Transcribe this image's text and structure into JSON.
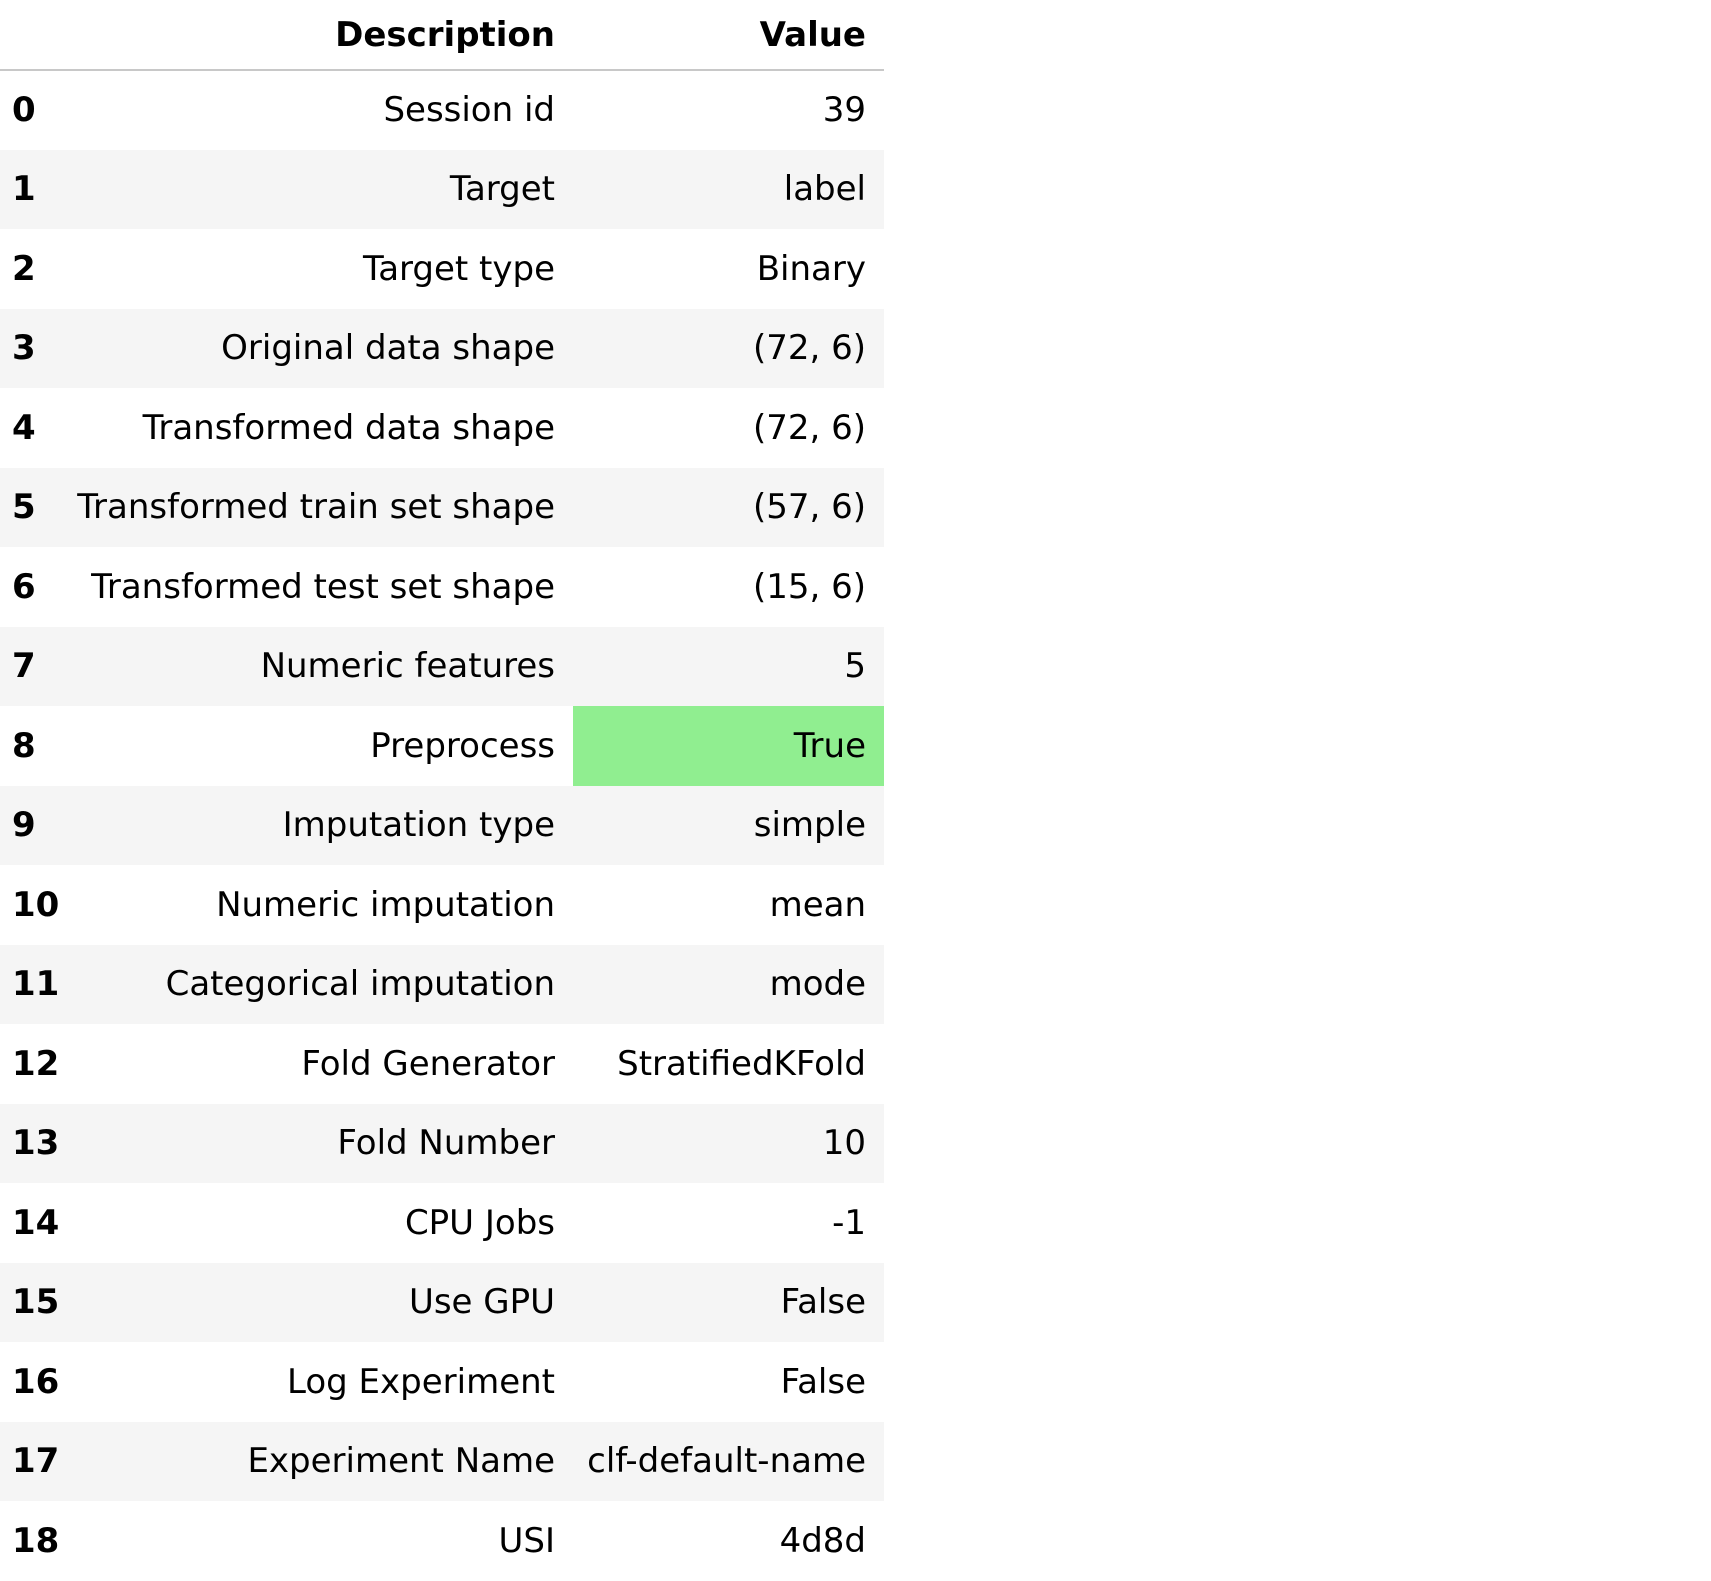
{
  "header": {
    "index": "",
    "description": "Description",
    "value": "Value"
  },
  "highlight_color": "#90ee90",
  "rows": [
    {
      "index": "0",
      "description": "Session id",
      "value": "39",
      "highlight": false
    },
    {
      "index": "1",
      "description": "Target",
      "value": "label",
      "highlight": false
    },
    {
      "index": "2",
      "description": "Target type",
      "value": "Binary",
      "highlight": false
    },
    {
      "index": "3",
      "description": "Original data shape",
      "value": "(72, 6)",
      "highlight": false
    },
    {
      "index": "4",
      "description": "Transformed data shape",
      "value": "(72, 6)",
      "highlight": false
    },
    {
      "index": "5",
      "description": "Transformed train set shape",
      "value": "(57, 6)",
      "highlight": false
    },
    {
      "index": "6",
      "description": "Transformed test set shape",
      "value": "(15, 6)",
      "highlight": false
    },
    {
      "index": "7",
      "description": "Numeric features",
      "value": "5",
      "highlight": false
    },
    {
      "index": "8",
      "description": "Preprocess",
      "value": "True",
      "highlight": true
    },
    {
      "index": "9",
      "description": "Imputation type",
      "value": "simple",
      "highlight": false
    },
    {
      "index": "10",
      "description": "Numeric imputation",
      "value": "mean",
      "highlight": false
    },
    {
      "index": "11",
      "description": "Categorical imputation",
      "value": "mode",
      "highlight": false
    },
    {
      "index": "12",
      "description": "Fold Generator",
      "value": "StratifiedKFold",
      "highlight": false
    },
    {
      "index": "13",
      "description": "Fold Number",
      "value": "10",
      "highlight": false
    },
    {
      "index": "14",
      "description": "CPU Jobs",
      "value": "-1",
      "highlight": false
    },
    {
      "index": "15",
      "description": "Use GPU",
      "value": "False",
      "highlight": false
    },
    {
      "index": "16",
      "description": "Log Experiment",
      "value": "False",
      "highlight": false
    },
    {
      "index": "17",
      "description": "Experiment Name",
      "value": "clf-default-name",
      "highlight": false
    },
    {
      "index": "18",
      "description": "USI",
      "value": "4d8d",
      "highlight": false
    }
  ]
}
